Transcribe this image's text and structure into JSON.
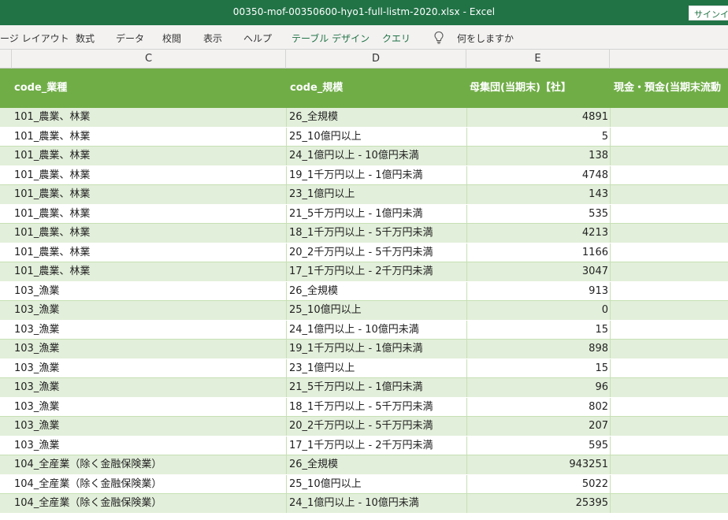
{
  "window": {
    "title": "00350-mof-00350600-hyo1-full-listm-2020.xlsx  -  Excel",
    "signin_label": "サインイ"
  },
  "ribbon": {
    "tabs": [
      {
        "label": "ージ レイアウト",
        "contextual": false
      },
      {
        "label": "数式",
        "contextual": false
      },
      {
        "label": "データ",
        "contextual": false
      },
      {
        "label": "校閲",
        "contextual": false
      },
      {
        "label": "表示",
        "contextual": false
      },
      {
        "label": "ヘルプ",
        "contextual": false
      },
      {
        "label": "テーブル デザイン",
        "contextual": true
      },
      {
        "label": "クエリ",
        "contextual": true
      }
    ],
    "tell_me": "何をしますか",
    "tell_me_icon": "lightbulb-icon"
  },
  "columns": [
    "C",
    "D",
    "E"
  ],
  "table": {
    "headers": [
      "code_業種",
      "code_規模",
      "母集団(当期末)【社】",
      "現金・預金(当期末流動"
    ],
    "rows": [
      [
        "101_農業、林業",
        "26_全規模",
        "4891"
      ],
      [
        "101_農業、林業",
        "25_10億円以上",
        "5"
      ],
      [
        "101_農業、林業",
        "24_1億円以上 - 10億円未満",
        "138"
      ],
      [
        "101_農業、林業",
        "19_1千万円以上 - 1億円未満",
        "4748"
      ],
      [
        "101_農業、林業",
        "23_1億円以上",
        "143"
      ],
      [
        "101_農業、林業",
        "21_5千万円以上 - 1億円未満",
        "535"
      ],
      [
        "101_農業、林業",
        "18_1千万円以上 - 5千万円未満",
        "4213"
      ],
      [
        "101_農業、林業",
        "20_2千万円以上 - 5千万円未満",
        "1166"
      ],
      [
        "101_農業、林業",
        "17_1千万円以上 - 2千万円未満",
        "3047"
      ],
      [
        "103_漁業",
        "26_全規模",
        "913"
      ],
      [
        "103_漁業",
        "25_10億円以上",
        "0"
      ],
      [
        "103_漁業",
        "24_1億円以上 - 10億円未満",
        "15"
      ],
      [
        "103_漁業",
        "19_1千万円以上 - 1億円未満",
        "898"
      ],
      [
        "103_漁業",
        "23_1億円以上",
        "15"
      ],
      [
        "103_漁業",
        "21_5千万円以上 - 1億円未満",
        "96"
      ],
      [
        "103_漁業",
        "18_1千万円以上 - 5千万円未満",
        "802"
      ],
      [
        "103_漁業",
        "20_2千万円以上 - 5千万円未満",
        "207"
      ],
      [
        "103_漁業",
        "17_1千万円以上 - 2千万円未満",
        "595"
      ],
      [
        "104_全産業（除く金融保険業）",
        "26_全規模",
        "943251"
      ],
      [
        "104_全産業（除く金融保険業）",
        "25_10億円以上",
        "5022"
      ],
      [
        "104_全産業（除く金融保険業）",
        "24_1億円以上 - 10億円未満",
        "25395"
      ]
    ]
  }
}
